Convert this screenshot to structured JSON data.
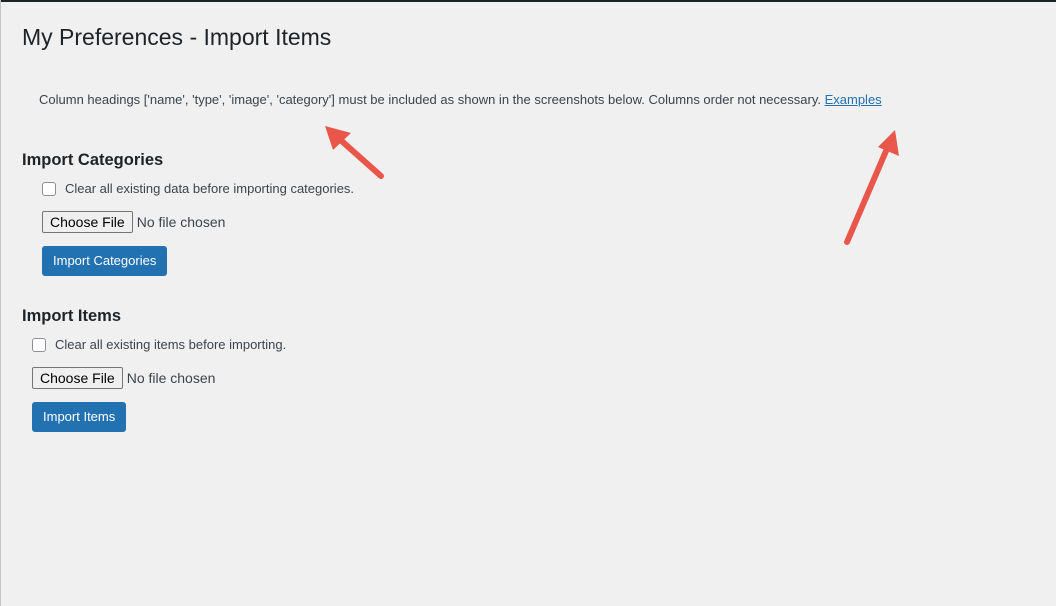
{
  "page": {
    "title": "My Preferences - Import Items"
  },
  "notice": {
    "text": "Column headings ['name', 'type', 'image', 'category'] must be included as shown in the screenshots below. Columns order not necessary.",
    "link_label": "Examples"
  },
  "categories": {
    "heading": "Import Categories",
    "clear_label": "Clear all existing data before importing categories.",
    "clear_checked": false,
    "choose_file_label": "Choose File",
    "file_status": "No file chosen",
    "import_button": "Import Categories"
  },
  "items": {
    "heading": "Import Items",
    "clear_label": "Clear all existing items before importing.",
    "clear_checked": false,
    "choose_file_label": "Choose File",
    "file_status": "No file chosen",
    "import_button": "Import Items"
  },
  "colors": {
    "background": "#f0f0f1",
    "primary": "#2271b1",
    "annotation_arrow": "#e9564a"
  },
  "annotations": [
    {
      "name": "annotation-arrow",
      "color": "#e9564a",
      "points_to": "column headings"
    },
    {
      "name": "annotation-arrow",
      "color": "#e9564a",
      "points_to": "Examples link"
    }
  ]
}
